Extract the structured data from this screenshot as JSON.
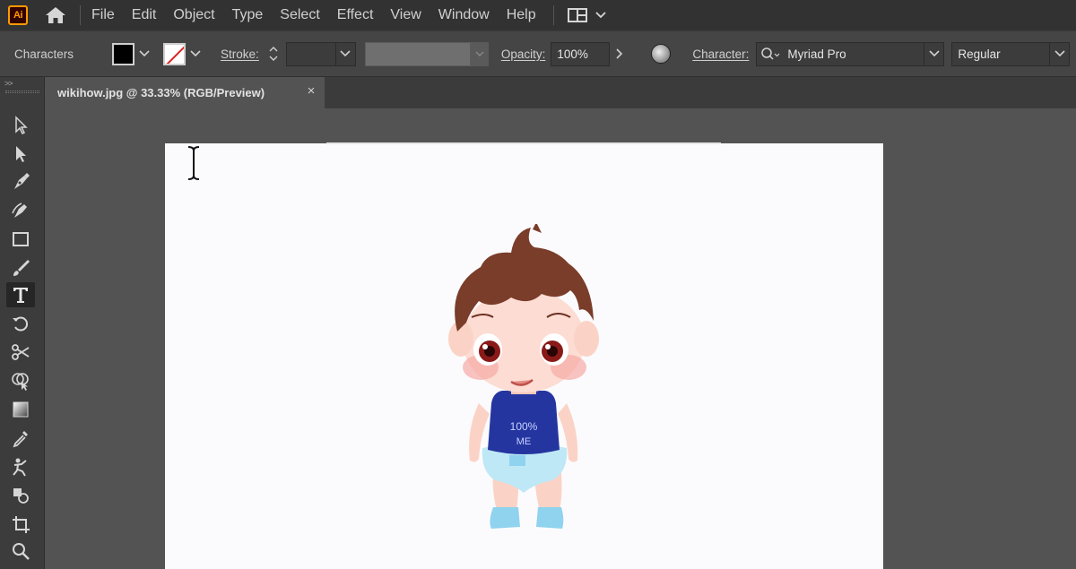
{
  "app": {
    "logo_text": "Ai",
    "accent": "#ff9a00"
  },
  "menu": {
    "items": [
      "File",
      "Edit",
      "Object",
      "Type",
      "Select",
      "Effect",
      "View",
      "Window",
      "Help"
    ]
  },
  "control_bar": {
    "panel_label": "Characters",
    "fill_color": "#000000",
    "stroke_label": "Stroke:",
    "stroke_value": "",
    "opacity_label": "Opacity:",
    "opacity_value": "100%",
    "character_label": "Character:",
    "font_family": "Myriad Pro",
    "font_style": "Regular"
  },
  "document_tab": {
    "title": "wikihow.jpg @ 33.33% (RGB/Preview)",
    "close_symbol": "×"
  },
  "toolbar": {
    "grip_symbol": ">>",
    "tools": [
      "selection-tool-icon",
      "direct-selection-tool-icon",
      "pen-tool-icon",
      "curvature-tool-icon",
      "rectangle-tool-icon",
      "paintbrush-tool-icon",
      "type-tool-icon",
      "rotate-tool-icon",
      "scissors-tool-icon",
      "shape-builder-tool-icon",
      "gradient-tool-icon",
      "eyedropper-tool-icon",
      "puppet-warp-tool-icon",
      "artboard-shapes-tool-icon",
      "artboard-tool-icon",
      "zoom-tool-icon"
    ],
    "active_tool": "type-tool-icon"
  },
  "artboard": {
    "image_text": "100%\nME",
    "colors": {
      "hair": "#7a3d2a",
      "skin": "#fbd8cf",
      "shirt": "#2535a0",
      "diaper": "#bfe8f6",
      "socks": "#8fd3ef"
    }
  }
}
